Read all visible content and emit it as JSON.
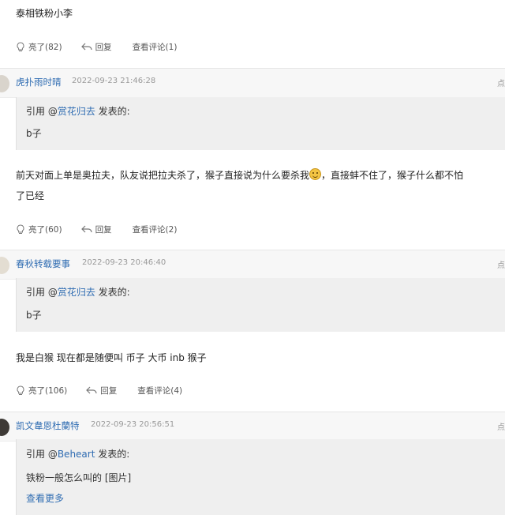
{
  "post0": {
    "body": "泰相铁粉小李",
    "like_label": "亮了(82)",
    "reply_label": "回复",
    "view_label": "查看评论(1)"
  },
  "post1": {
    "username": "虎扑雨时晴",
    "time": "2022-09-23 21:46:28",
    "cut_label": "点亮",
    "quote_prefix": "引用 @",
    "quote_user": "赏花归去",
    "quote_suffix": " 发表的:",
    "quote_text": "b子",
    "body_a": "前天对面上单是奥拉夫，队友说把拉夫杀了，猴子直接说为什么要杀我",
    "body_b": "，直接蚌不住了，猴子什么都不怕",
    "body_c": "了已经",
    "like_label": "亮了(60)",
    "reply_label": "回复",
    "view_label": "查看评论(2)"
  },
  "post2": {
    "username": "春秋转载要事",
    "time": "2022-09-23 20:46:40",
    "cut_label": "点亮",
    "quote_prefix": "引用 @",
    "quote_user": "赏花归去",
    "quote_suffix": " 发表的:",
    "quote_text": "b子",
    "body": "我是白猴 现在都是随便叫 币子 大币 inb 猴子",
    "like_label": "亮了(106)",
    "reply_label": "回复",
    "view_label": "查看评论(4)"
  },
  "post3": {
    "username": "凯文韋恩杜蘭特",
    "time": "2022-09-23 20:56:51",
    "cut_label": "点亮",
    "quote_prefix": "引用 @",
    "quote_user": "Beheart",
    "quote_suffix": " 发表的:",
    "quote_text": "铁粉一般怎么叫的 [图片]",
    "more_label": "查看更多"
  },
  "colors": {
    "link": "#2f6cb2",
    "header_bg": "#f7f7f7",
    "quote_bg": "#efefef"
  }
}
